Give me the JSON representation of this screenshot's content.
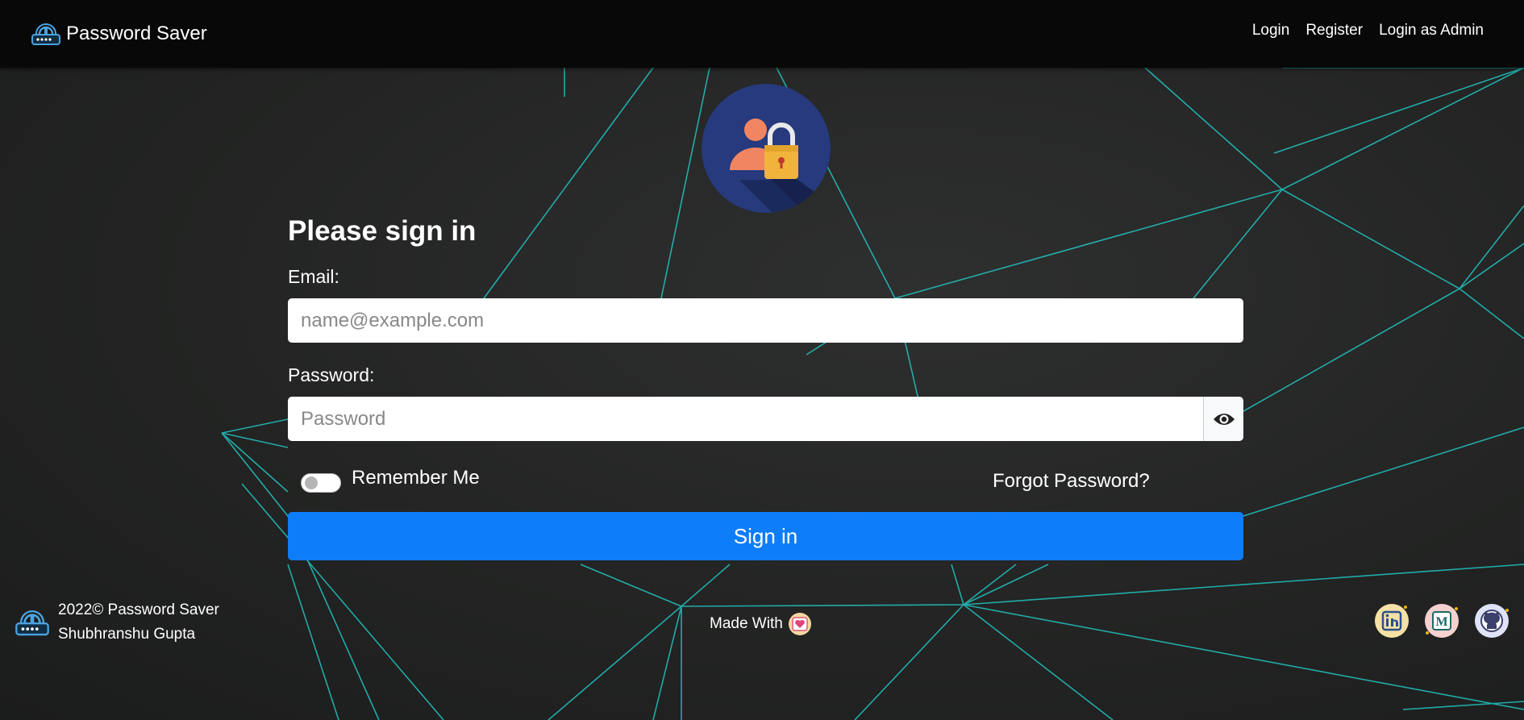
{
  "navbar": {
    "brand": "Password Saver",
    "links": [
      "Login",
      "Register",
      "Login as Admin"
    ]
  },
  "form": {
    "heading": "Please sign in",
    "email_label": "Email:",
    "email_placeholder": "name@example.com",
    "password_label": "Password:",
    "password_placeholder": "Password",
    "remember_label": "Remember Me",
    "forgot_label": "Forgot Password?",
    "signin_label": "Sign in"
  },
  "footer": {
    "copyright": "2022© Password Saver",
    "author": "Shubhranshu Gupta",
    "made_with": "Made With"
  },
  "colors": {
    "primary": "#0d7df9",
    "line": "#22c3c0",
    "navbar": "#080808",
    "avatar_bg": "#263a7d"
  },
  "icons": [
    "router-icon",
    "user-lock-icon",
    "eye-icon",
    "heart-icon",
    "linkedin-icon",
    "medium-icon",
    "github-icon"
  ]
}
